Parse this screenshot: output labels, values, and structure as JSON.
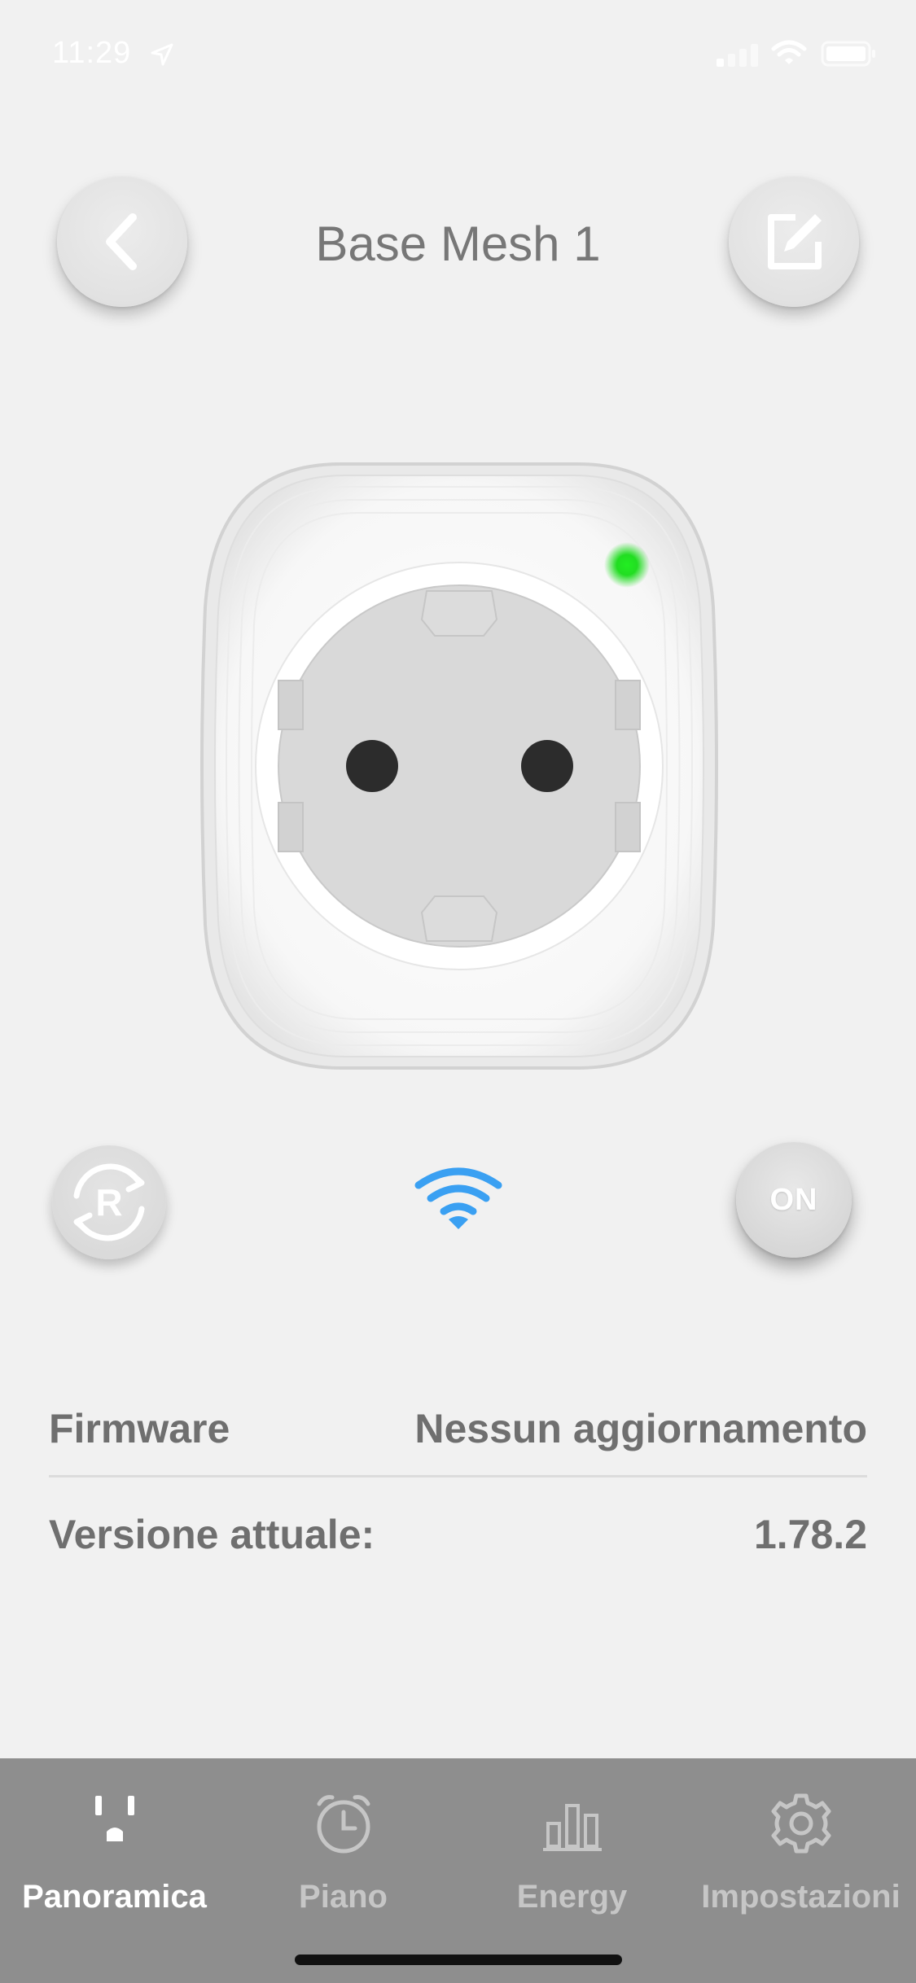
{
  "status_bar": {
    "time": "11:29"
  },
  "header": {
    "title": "Base Mesh 1"
  },
  "controls": {
    "power_label": "ON",
    "reset_letter": "R"
  },
  "info": {
    "firmware_label": "Firmware",
    "firmware_value": "Nessun aggiornamento",
    "version_label": "Versione attuale:",
    "version_value": "1.78.2"
  },
  "tabs": [
    {
      "label": "Panoramica",
      "icon": "outlet-icon",
      "active": true
    },
    {
      "label": "Piano",
      "icon": "alarm-clock-icon",
      "active": false
    },
    {
      "label": "Energy",
      "icon": "bar-chart-icon",
      "active": false
    },
    {
      "label": "Impostazioni",
      "icon": "gear-icon",
      "active": false
    }
  ],
  "colors": {
    "background": "#f1f1f1",
    "tab_bar": "#8e8e8e",
    "wifi_blue": "#3aa0f2",
    "led_green": "#22dd22",
    "text_gray": "#6f6f6f"
  }
}
